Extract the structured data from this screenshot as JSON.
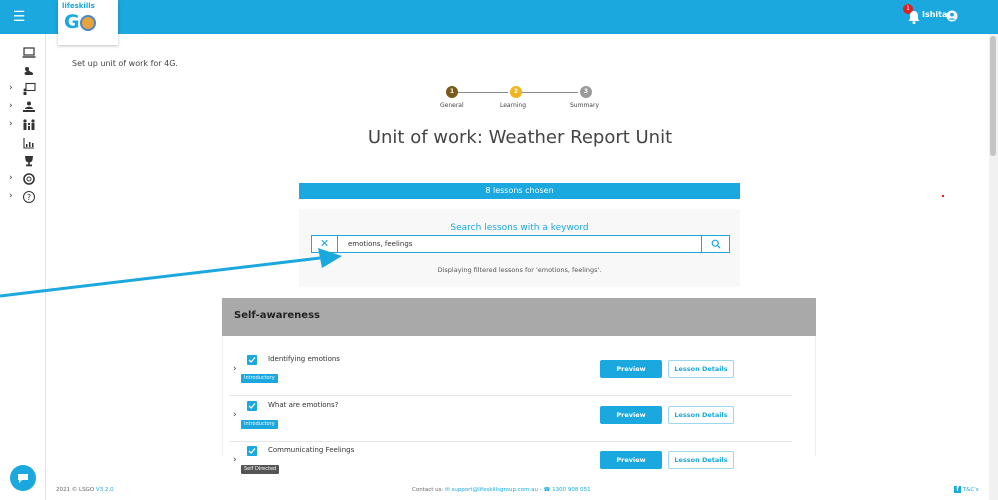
{
  "header": {
    "logo_small": "lifeskills",
    "logo_main": "G",
    "notification_count": "1",
    "user_name": "Ishita"
  },
  "colors": {
    "accent": "#1aa8df",
    "section_header": "#a9a9a9",
    "badge_introductory": "#1aa8df",
    "badge_self_directed": "#555555",
    "step_complete": "#7a5a1a",
    "step_active": "#f2b41c",
    "step_pending": "#9a9a9a"
  },
  "sidebar": {
    "items": [
      {
        "icon": "laptop-icon",
        "has_chevron": false
      },
      {
        "icon": "weather-icon",
        "has_chevron": false
      },
      {
        "icon": "presentation-icon",
        "has_chevron": true
      },
      {
        "icon": "teacher-icon",
        "has_chevron": true
      },
      {
        "icon": "family-icon",
        "has_chevron": true
      },
      {
        "icon": "chart-icon",
        "has_chevron": false
      },
      {
        "icon": "trophy-icon",
        "has_chevron": false
      },
      {
        "icon": "lifebuoy-icon",
        "has_chevron": true
      },
      {
        "icon": "help-icon",
        "has_chevron": true
      }
    ]
  },
  "main": {
    "setup_text": "Set up unit of work for 4G.",
    "steps": [
      {
        "number": "1",
        "label": "General"
      },
      {
        "number": "2",
        "label": "Learning"
      },
      {
        "number": "3",
        "label": "Summary"
      }
    ],
    "title": "Unit of work: Weather Report Unit",
    "lessons_chosen": "8 lessons chosen",
    "search": {
      "title": "Search lessons with a keyword",
      "value": "emotions, feelings",
      "filter_message": "Displaying filtered lessons for 'emotions, feelings'."
    },
    "section": {
      "title": "Self-awareness",
      "lessons": [
        {
          "name": "Identifying emotions",
          "badge": "Introductory",
          "preview": "Preview",
          "details": "Lesson Details"
        },
        {
          "name": "What are emotions?",
          "badge": "Introductory",
          "preview": "Preview",
          "details": "Lesson Details"
        },
        {
          "name": "Communicating Feelings",
          "badge": "Self Directed",
          "preview": "Preview",
          "details": "Lesson Details"
        }
      ]
    }
  },
  "footer": {
    "year": "2021",
    "brand": "LSGO",
    "version": "V3.2.0",
    "contact_label": "Contact us:",
    "email": "support@lifeskillsgroup.com.au",
    "separator": "-",
    "phone": "1300 908 051",
    "tcs": "T&C's"
  }
}
